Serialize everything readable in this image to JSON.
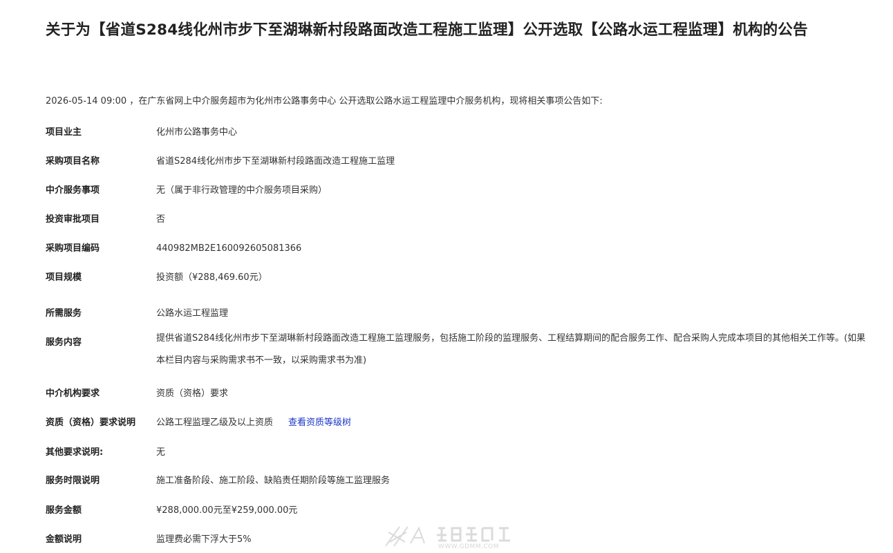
{
  "title": "关于为【省道S284线化州市步下至湖琳新村段路面改造工程施工监理】公开选取【公路水运工程监理】机构的公告",
  "intro": "2026-05-14 09:00 ，在广东省网上中介服务超市为化州市公路事务中心 公开选取公路水运工程监理中介服务机构，现将相关事项公告如下:",
  "rows": [
    {
      "label": "项目业主",
      "value": "化州市公路事务中心"
    },
    {
      "label": "采购项目名称",
      "value": "省道S284线化州市步下至湖琳新村段路面改造工程施工监理"
    },
    {
      "label": "中介服务事项",
      "value": "无（属于非行政管理的中介服务项目采购）"
    },
    {
      "label": "投资审批项目",
      "value": "否"
    },
    {
      "label": "采购项目编码",
      "value": "440982MB2E160092605081366"
    },
    {
      "label": "项目规模",
      "value": "投资额（¥288,469.60元）"
    },
    {
      "label": "所需服务",
      "value": "公路水运工程监理"
    },
    {
      "label": "服务内容",
      "value": "提供省道S284线化州市步下至湖琳新村段路面改造工程施工监理服务，包括施工阶段的监理服务、工程结算期间的配合服务工作、配合采购人完成本项目的其他相关工作等。(如果本栏目内容与采购需求书不一致，以采购需求书为准)"
    },
    {
      "label": "中介机构要求",
      "value": "资质（资格）要求"
    },
    {
      "label": "资质（资格）要求说明",
      "value": "公路工程监理乙级及以上资质",
      "link": "查看资质等级树"
    },
    {
      "label": "其他要求说明:",
      "value": "无"
    },
    {
      "label": "服务时限说明",
      "value": "施工准备阶段、施工阶段、缺陷责任期阶段等施工监理服务"
    },
    {
      "label": "服务金额",
      "value": "¥288,000.00元至¥259,000.00元"
    },
    {
      "label": "金额说明",
      "value": "监理费必需下浮大于5%"
    }
  ],
  "watermark": {
    "text": "WWW.GDMM.COM"
  },
  "colors": {
    "link": "#1a35c9",
    "text": "#333333",
    "title": "#222222"
  }
}
